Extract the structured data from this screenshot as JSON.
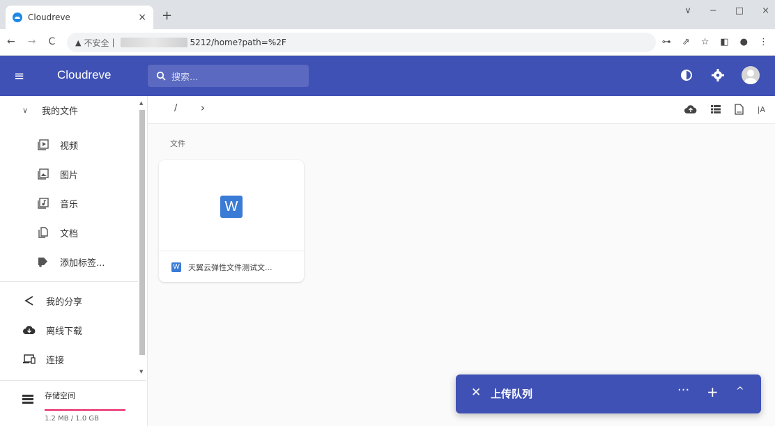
{
  "browser": {
    "tab_title": "Cloudreve",
    "tab_close": "×",
    "new_tab": "+",
    "controls": {
      "collapse": "∨",
      "minimize": "−",
      "maximize": "□",
      "close": "×"
    },
    "security_text": "不安全",
    "url_separator": "|",
    "url_tail": "5212/home?path=%2F"
  },
  "app": {
    "title": "Cloudreve",
    "search_placeholder": "搜索..."
  },
  "sidebar": {
    "my_files": "我的文件",
    "items": [
      {
        "label": "视频",
        "icon": "video-icon"
      },
      {
        "label": "图片",
        "icon": "image-icon"
      },
      {
        "label": "音乐",
        "icon": "music-icon"
      },
      {
        "label": "文档",
        "icon": "document-icon"
      },
      {
        "label": "添加标签...",
        "icon": "tag-add-icon"
      }
    ],
    "share": "我的分享",
    "offline": "离线下载",
    "connect": "连接",
    "storage_label": "存储空间",
    "storage_value": "1.2 MB / 1.0 GB"
  },
  "breadcrumb": {
    "root": "/",
    "arrow": "›",
    "sort_label": "|A"
  },
  "main": {
    "section": "文件",
    "file": {
      "icon_letter": "W",
      "name": "天翼云弹性文件测试文..."
    }
  },
  "upload": {
    "close": "✕",
    "title": "上传队列",
    "more": "···",
    "add": "+",
    "collapse": "^"
  },
  "colors": {
    "appbar": "#3f51b5",
    "storage_bar": "#e91e63",
    "word": "#3a7bd5"
  }
}
